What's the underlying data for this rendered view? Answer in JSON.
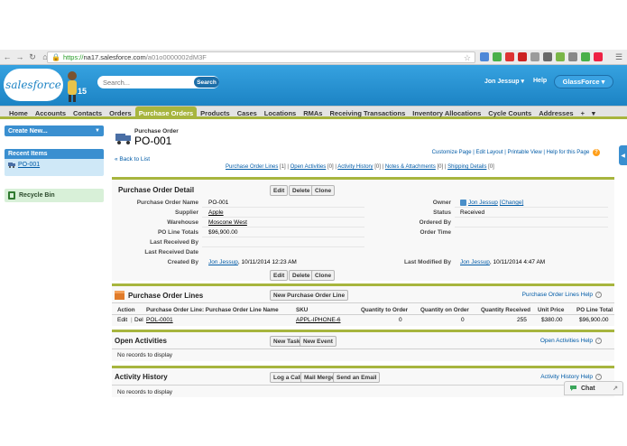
{
  "browser": {
    "url_scheme": "https://",
    "url_host": "na17.salesforce.com",
    "url_path": "/a01o0000002dM3F"
  },
  "header": {
    "logo": "salesforce",
    "logo_badge": "15",
    "search_placeholder": "Search...",
    "search_button": "Search",
    "user": "Jon Jessup",
    "help": "Help",
    "app": "GlassForce"
  },
  "tabs": [
    "Home",
    "Accounts",
    "Contacts",
    "Orders",
    "Purchase Orders",
    "Products",
    "Cases",
    "Locations",
    "RMAs",
    "Receiving Transactions",
    "Inventory Allocations",
    "Cycle Counts",
    "Addresses",
    "+"
  ],
  "sidebar": {
    "create_new": "Create New...",
    "recent_items_title": "Recent Items",
    "recent_items": [
      "PO-001"
    ],
    "recycle_bin": "Recycle Bin"
  },
  "page": {
    "object_label": "Purchase Order",
    "record_name": "PO-001",
    "customize": "Customize Page",
    "edit_layout": "Edit Layout",
    "printable": "Printable View",
    "help_page": "Help for this Page",
    "back": "« Back to List",
    "related": {
      "po_lines": "Purchase Order Lines",
      "po_lines_count": "[1]",
      "open_activities": "Open Activities",
      "open_activities_count": "[0]",
      "activity_history": "Activity History",
      "activity_history_count": "[0]",
      "notes": "Notes & Attachments",
      "notes_count": "[0]",
      "shipping": "Shipping Details",
      "shipping_count": "[0]"
    }
  },
  "detail": {
    "title": "Purchase Order Detail",
    "buttons": [
      "Edit",
      "Delete",
      "Clone"
    ],
    "left_fields": [
      {
        "label": "Purchase Order Name",
        "value": "PO-001"
      },
      {
        "label": "Supplier",
        "value": "Apple"
      },
      {
        "label": "Warehouse",
        "value": "Moscone West"
      },
      {
        "label": "PO Line Totals",
        "value": "$96,900.00"
      },
      {
        "label": "Last Received By",
        "value": ""
      },
      {
        "label": "Last Received Date",
        "value": ""
      },
      {
        "label": "Created By",
        "value": "Jon Jessup",
        "extra": ", 10/11/2014 12:23 AM"
      }
    ],
    "right_fields": [
      {
        "label": "Owner",
        "value": "Jon Jessup",
        "extra": "[Change]"
      },
      {
        "label": "Status",
        "value": "Received"
      },
      {
        "label": "Ordered By",
        "value": ""
      },
      {
        "label": "Order Time",
        "value": ""
      },
      {
        "label": "Last Modified By",
        "value": "Jon Jessup",
        "extra": ", 10/11/2014 4:47 AM"
      }
    ]
  },
  "po_lines": {
    "title": "Purchase Order Lines",
    "new_button": "New Purchase Order Line",
    "help": "Purchase Order Lines Help",
    "columns": [
      "Action",
      "Purchase Order Line: Purchase Order Line Name",
      "SKU",
      "Quantity to Order",
      "Quantity on Order",
      "Quantity Received",
      "Unit Price",
      "PO Line Total"
    ],
    "rows": [
      {
        "edit": "Edit",
        "sep": "|",
        "del": "Del",
        "name": "POL-0001",
        "sku": "APPL-IPHONE-6",
        "qty_order": "0",
        "qty_on_order": "0",
        "qty_received": "255",
        "unit_price": "$380.00",
        "total": "$96,900.00"
      }
    ]
  },
  "open_activities": {
    "title": "Open Activities",
    "buttons": [
      "New Task",
      "New Event"
    ],
    "help": "Open Activities Help",
    "empty": "No records to display"
  },
  "activity_history": {
    "title": "Activity History",
    "buttons": [
      "Log a Call",
      "Mail Merge",
      "Send an Email"
    ],
    "help": "Activity History Help",
    "empty": "No records to display"
  },
  "chat": {
    "label": "Chat"
  },
  "colors": {
    "header_blue": "#2a94d6",
    "tab_accent": "#a7b53e",
    "link": "#015ba7"
  }
}
